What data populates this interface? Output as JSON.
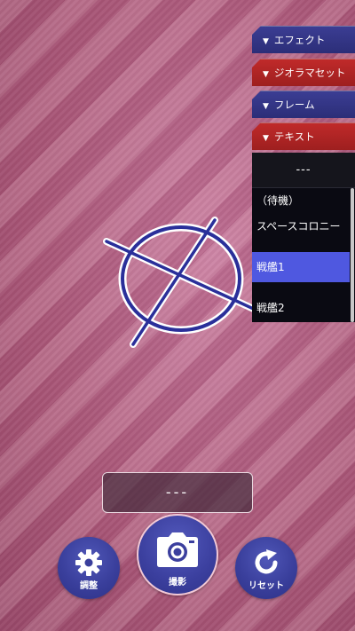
{
  "menu": {
    "tabs": [
      {
        "label": "エフェクト",
        "marker": "▼",
        "color": "#33358a"
      },
      {
        "label": "ジオラマセット",
        "marker": "▼",
        "color": "#b02525"
      },
      {
        "label": "フレーム",
        "marker": "▼",
        "color": "#33358a"
      },
      {
        "label": "テキスト",
        "marker": "▼",
        "color": "#b02525"
      }
    ]
  },
  "dropdown": {
    "current": "---",
    "items": [
      "（待機）",
      "スペースコロニー",
      "戦艦1",
      "戦艦2"
    ],
    "selected": "戦艦1"
  },
  "status": {
    "text": "---"
  },
  "controls": {
    "adjust_label": "調整",
    "shoot_label": "撮影",
    "reset_label": "リセット"
  },
  "icons": {
    "adjust": "gear-icon",
    "shoot": "camera-icon",
    "reset": "refresh-icon",
    "crosshair": "target-crosshair-icon"
  },
  "colors": {
    "accent": "#3a3f9c",
    "selected_item": "#4f58e0",
    "red_tab": "#b02525",
    "blue_tab": "#33358a"
  }
}
